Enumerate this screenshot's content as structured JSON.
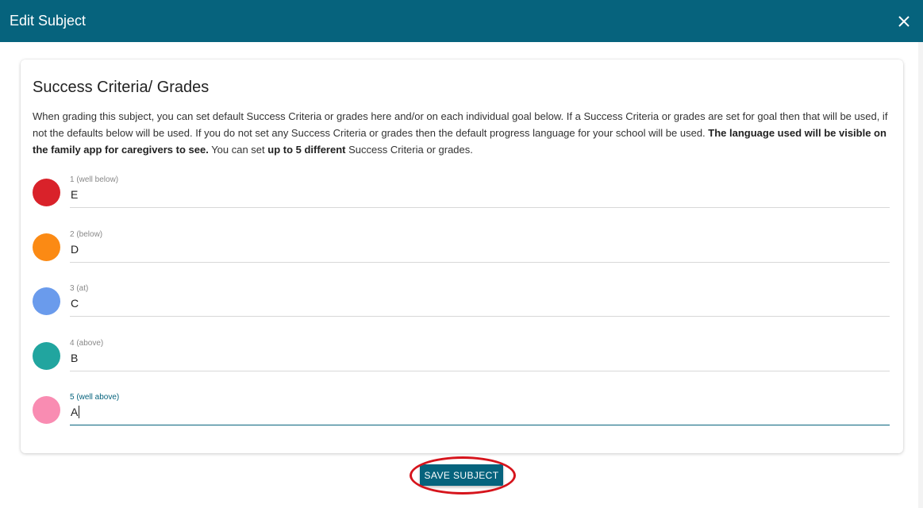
{
  "dialog": {
    "title": "Edit Subject",
    "close_icon": "close-icon"
  },
  "section": {
    "heading": "Success Criteria/ Grades",
    "desc_part1": "When grading this subject, you can set default Success Criteria or grades here and/or on each individual goal below. If a Success Criteria or grades are set for goal then that will be used, if not the defaults below will be used. If you do not set any Success Criteria or grades then the default progress language for your school will be used. ",
    "desc_bold1": "The language used will be visible on the family app for caregivers to see.",
    "desc_part2": " You can set ",
    "desc_bold2": "up to 5 different",
    "desc_part3": " Success Criteria or grades."
  },
  "criteria": [
    {
      "label": "1 (well below)",
      "value": "E",
      "color": "#d9222a"
    },
    {
      "label": "2 (below)",
      "value": "D",
      "color": "#fb8a14"
    },
    {
      "label": "3 (at)",
      "value": "C",
      "color": "#6a9bec"
    },
    {
      "label": "4 (above)",
      "value": "B",
      "color": "#21a59f"
    },
    {
      "label": "5 (well above)",
      "value": "A",
      "color": "#f98cb2"
    }
  ],
  "actions": {
    "save_label": "SAVE SUBJECT",
    "highlight_color": "#d6141c"
  },
  "theme": {
    "primary": "#06637d"
  }
}
